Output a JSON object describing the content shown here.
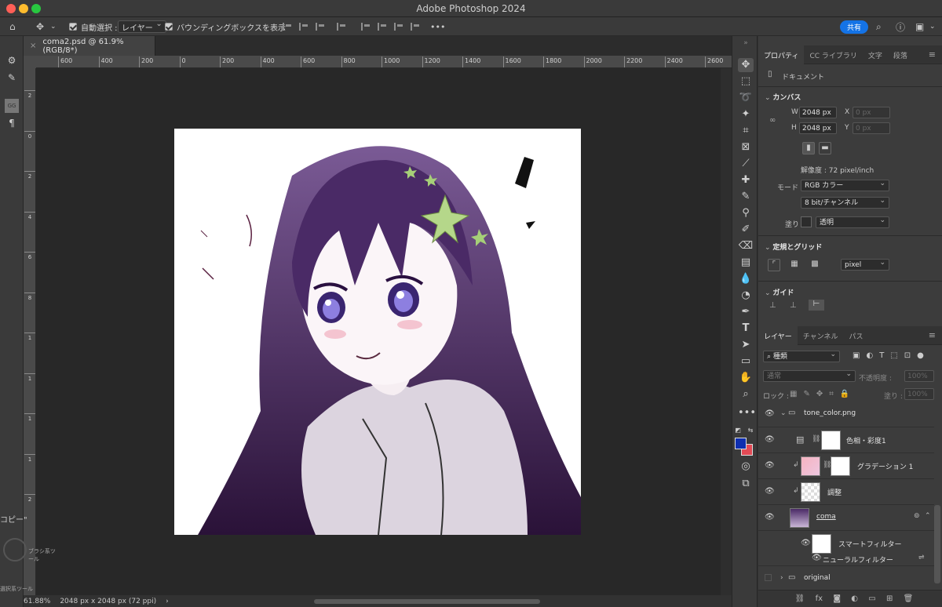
{
  "window": {
    "title": "Adobe Photoshop 2024"
  },
  "options_bar": {
    "auto_select_label": "自動選択 :",
    "auto_select_target": "レイヤー",
    "bounding_box_label": "バウンディングボックスを表示",
    "share_label": "共有",
    "more_label": "•••"
  },
  "document": {
    "tab_title": "coma2.psd @ 61.9% (RGB/8*)",
    "zoom": "61.88%",
    "dimensions": "2048 px x 2048 px (72 ppi)"
  },
  "rulers": {
    "horizontal": [
      "600",
      "400",
      "200",
      "0",
      "200",
      "400",
      "600",
      "800",
      "1000",
      "1200",
      "1400",
      "1600",
      "1800",
      "2000",
      "2200",
      "2400",
      "2600"
    ],
    "vertical": [
      "2",
      "0",
      "2",
      "4",
      "6",
      "8",
      "1",
      "1",
      "1",
      "1",
      "2"
    ]
  },
  "floating": {
    "copy_label": "コピー\"",
    "brush_label": "ブラシ系ツール",
    "select_label": "選択系ツール"
  },
  "properties": {
    "tabs": [
      "プロパティ",
      "CC ライブラリ",
      "文字",
      "段落"
    ],
    "doc_type": "ドキュメント",
    "canvas_title": "カンバス",
    "w_label": "W",
    "w_value": "2048 px",
    "h_label": "H",
    "h_value": "2048 px",
    "x_label": "X",
    "x_value": "0 px",
    "y_label": "Y",
    "y_value": "0 px",
    "resolution": "解像度 : 72 pixel/inch",
    "mode_label": "モード",
    "mode_value": "RGB カラー",
    "bit_value": "8 bit/チャンネル",
    "fill_label": "塗り",
    "fill_value": "透明",
    "grid_title": "定規とグリッド",
    "unit_value": "pixel",
    "guide_title": "ガイド"
  },
  "layers_panel": {
    "tabs": [
      "レイヤー",
      "チャンネル",
      "パス"
    ],
    "filter_label": "種類",
    "blend_mode": "通常",
    "opacity_label": "不透明度 :",
    "opacity_value": "100%",
    "lock_label": "ロック :",
    "fill_label": "塗り :",
    "fill_value": "100%",
    "layers": [
      {
        "name": "tone_color.png",
        "type": "group"
      },
      {
        "name": "色相・彩度1",
        "type": "adjustment"
      },
      {
        "name": "グラデーション 1",
        "type": "gradient"
      },
      {
        "name": "調整",
        "type": "pixel"
      },
      {
        "name": "coma",
        "type": "smart"
      },
      {
        "name": "スマートフィルター",
        "type": "filter-mask"
      },
      {
        "name": "ニューラルフィルター",
        "type": "filter"
      },
      {
        "name": "original",
        "type": "group"
      }
    ]
  },
  "colors": {
    "foreground": "#0f2fb0",
    "background": "#e24a55",
    "accent": "#1473e6"
  }
}
